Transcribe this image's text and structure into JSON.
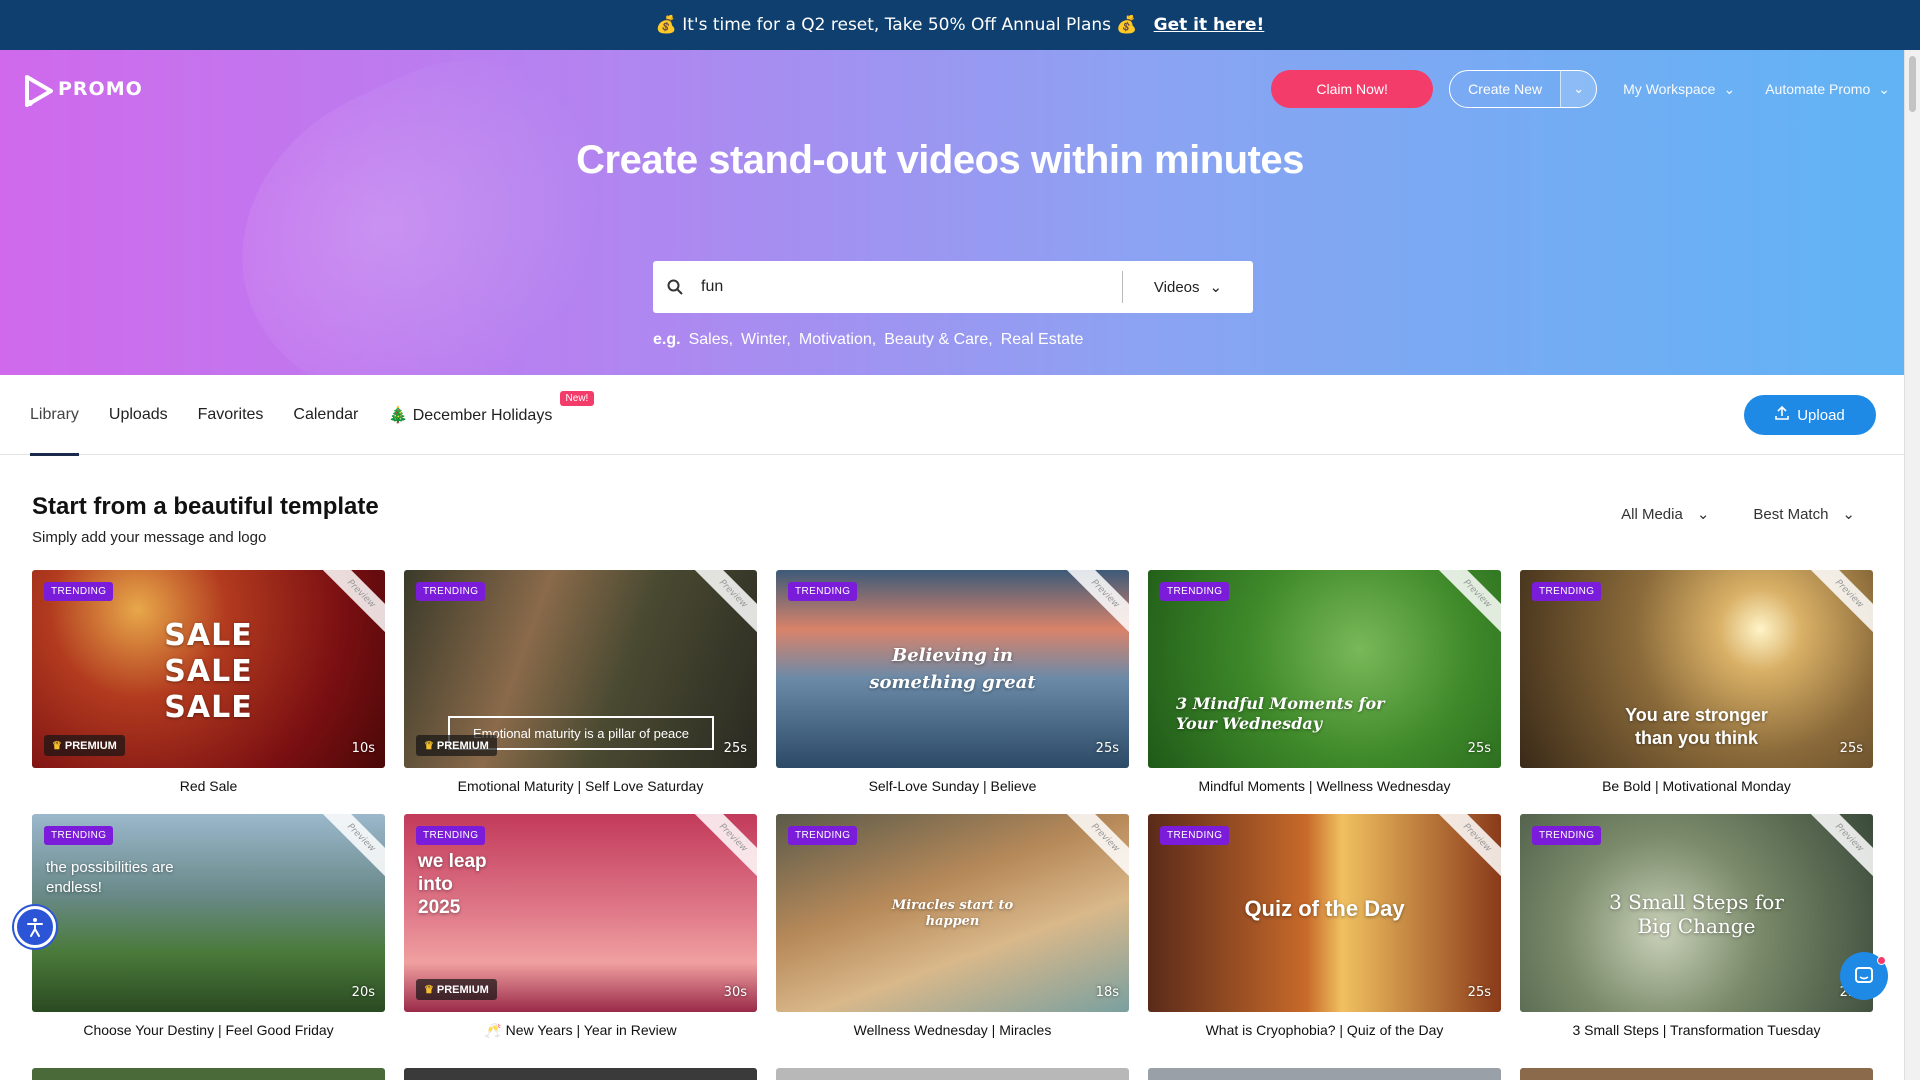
{
  "banner": {
    "text": "💰 It's time for a Q2 reset, Take 50% Off Annual Plans 💰",
    "cta": "Get it here!"
  },
  "header": {
    "logo": "PROMO",
    "claim": "Claim Now!",
    "create_new": "Create New",
    "workspace": "My Workspace",
    "automate": "Automate Promo"
  },
  "hero": {
    "title": "Create stand-out videos within minutes",
    "search_value": "fun",
    "search_type": "Videos",
    "eg_prefix": "e.g.",
    "examples": [
      "Sales,",
      "Winter,",
      "Motivation,",
      "Beauty & Care,",
      "Real Estate"
    ]
  },
  "tabs": {
    "items": [
      "Library",
      "Uploads",
      "Favorites",
      "Calendar",
      "🎄 December Holidays"
    ],
    "new_badge": "New!",
    "upload": "Upload"
  },
  "section": {
    "title": "Start from a beautiful template",
    "subtitle": "Simply add your message and logo",
    "filter_media": "All Media",
    "filter_sort": "Best Match"
  },
  "labels": {
    "trending": "TRENDING",
    "premium": "PREMIUM",
    "preview": "Preview"
  },
  "cards": [
    {
      "title": "Red Sale",
      "duration": "10s",
      "overlay": "SALE\nSALE\nSALE",
      "premium": true
    },
    {
      "title": "Emotional Maturity | Self Love Saturday",
      "duration": "25s",
      "overlay": "Emotional maturity is a pillar of peace",
      "premium": true
    },
    {
      "title": "Self-Love Sunday | Believe",
      "duration": "25s",
      "overlay": "Believing in something great",
      "premium": false
    },
    {
      "title": "Mindful Moments | Wellness Wednesday",
      "duration": "25s",
      "overlay": "3 Mindful Moments for Your Wednesday",
      "premium": false
    },
    {
      "title": "Be Bold | Motivational Monday",
      "duration": "25s",
      "overlay": "You are stronger than you think",
      "premium": false
    },
    {
      "title": "Choose Your Destiny | Feel Good Friday",
      "duration": "20s",
      "overlay": "the possibilities are endless!",
      "premium": false
    },
    {
      "title": "🥂 New Years | Year in Review",
      "duration": "30s",
      "overlay": "we leap into 2025",
      "premium": true
    },
    {
      "title": "Wellness Wednesday | Miracles",
      "duration": "18s",
      "overlay": "Miracles start to happen",
      "premium": false
    },
    {
      "title": "What is Cryophobia? | Quiz of the Day",
      "duration": "25s",
      "overlay": "Quiz of the Day",
      "premium": false
    },
    {
      "title": "3 Small Steps | Transformation Tuesday",
      "duration": "25s",
      "overlay": "3 Small Steps for Big Change",
      "premium": false
    }
  ]
}
